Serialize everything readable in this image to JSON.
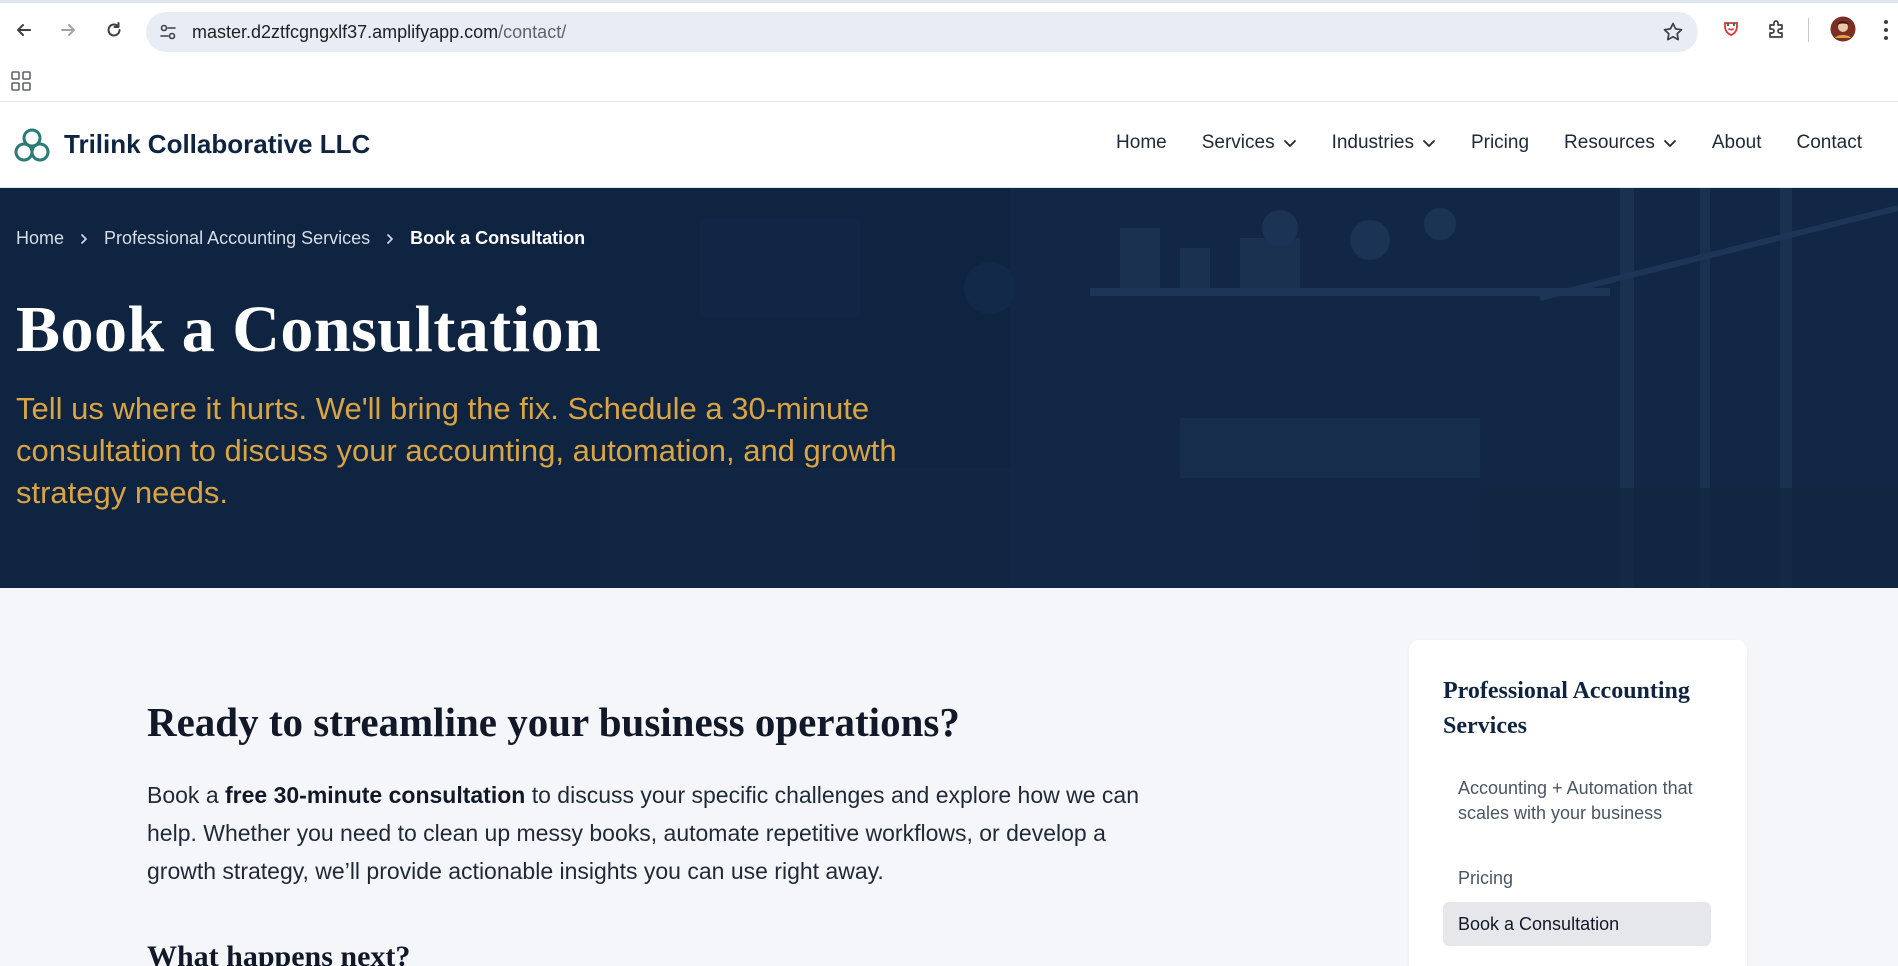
{
  "browser": {
    "url_host": "master.d2ztfcgngxlf37.amplifyapp.com",
    "url_path": "/contact/"
  },
  "site": {
    "brand": "Trilink Collaborative LLC",
    "nav": [
      {
        "label": "Home",
        "dropdown": false
      },
      {
        "label": "Services",
        "dropdown": true
      },
      {
        "label": "Industries",
        "dropdown": true
      },
      {
        "label": "Pricing",
        "dropdown": false
      },
      {
        "label": "Resources",
        "dropdown": true
      },
      {
        "label": "About",
        "dropdown": false
      },
      {
        "label": "Contact",
        "dropdown": false
      }
    ]
  },
  "hero": {
    "breadcrumbs": [
      "Home",
      "Professional Accounting Services",
      "Book a Consultation"
    ],
    "title": "Book a Consultation",
    "subtitle": "Tell us where it hurts. We'll bring the fix. Schedule a 30-minute consultation to discuss your accounting, automation, and growth strategy needs."
  },
  "main": {
    "heading": "Ready to streamline your business operations?",
    "para_before": "Book a ",
    "para_bold": "free 30-minute consultation",
    "para_after": " to discuss your specific challenges and explore how we can help. Whether you need to clean up messy books, automate repetitive workflows, or develop a growth strategy, we’ll provide actionable insights you can use right away.",
    "next_heading": "What happens next?"
  },
  "sidebar": {
    "title": "Professional Accounting Services",
    "links": [
      {
        "label": "Accounting + Automation that scales with your business",
        "active": false
      },
      {
        "label": "Pricing",
        "active": false
      },
      {
        "label": "Book a Consultation",
        "active": true
      }
    ]
  },
  "colors": {
    "navy": "#0f2440",
    "gold": "#d9a441",
    "teal": "#2a7a78"
  }
}
